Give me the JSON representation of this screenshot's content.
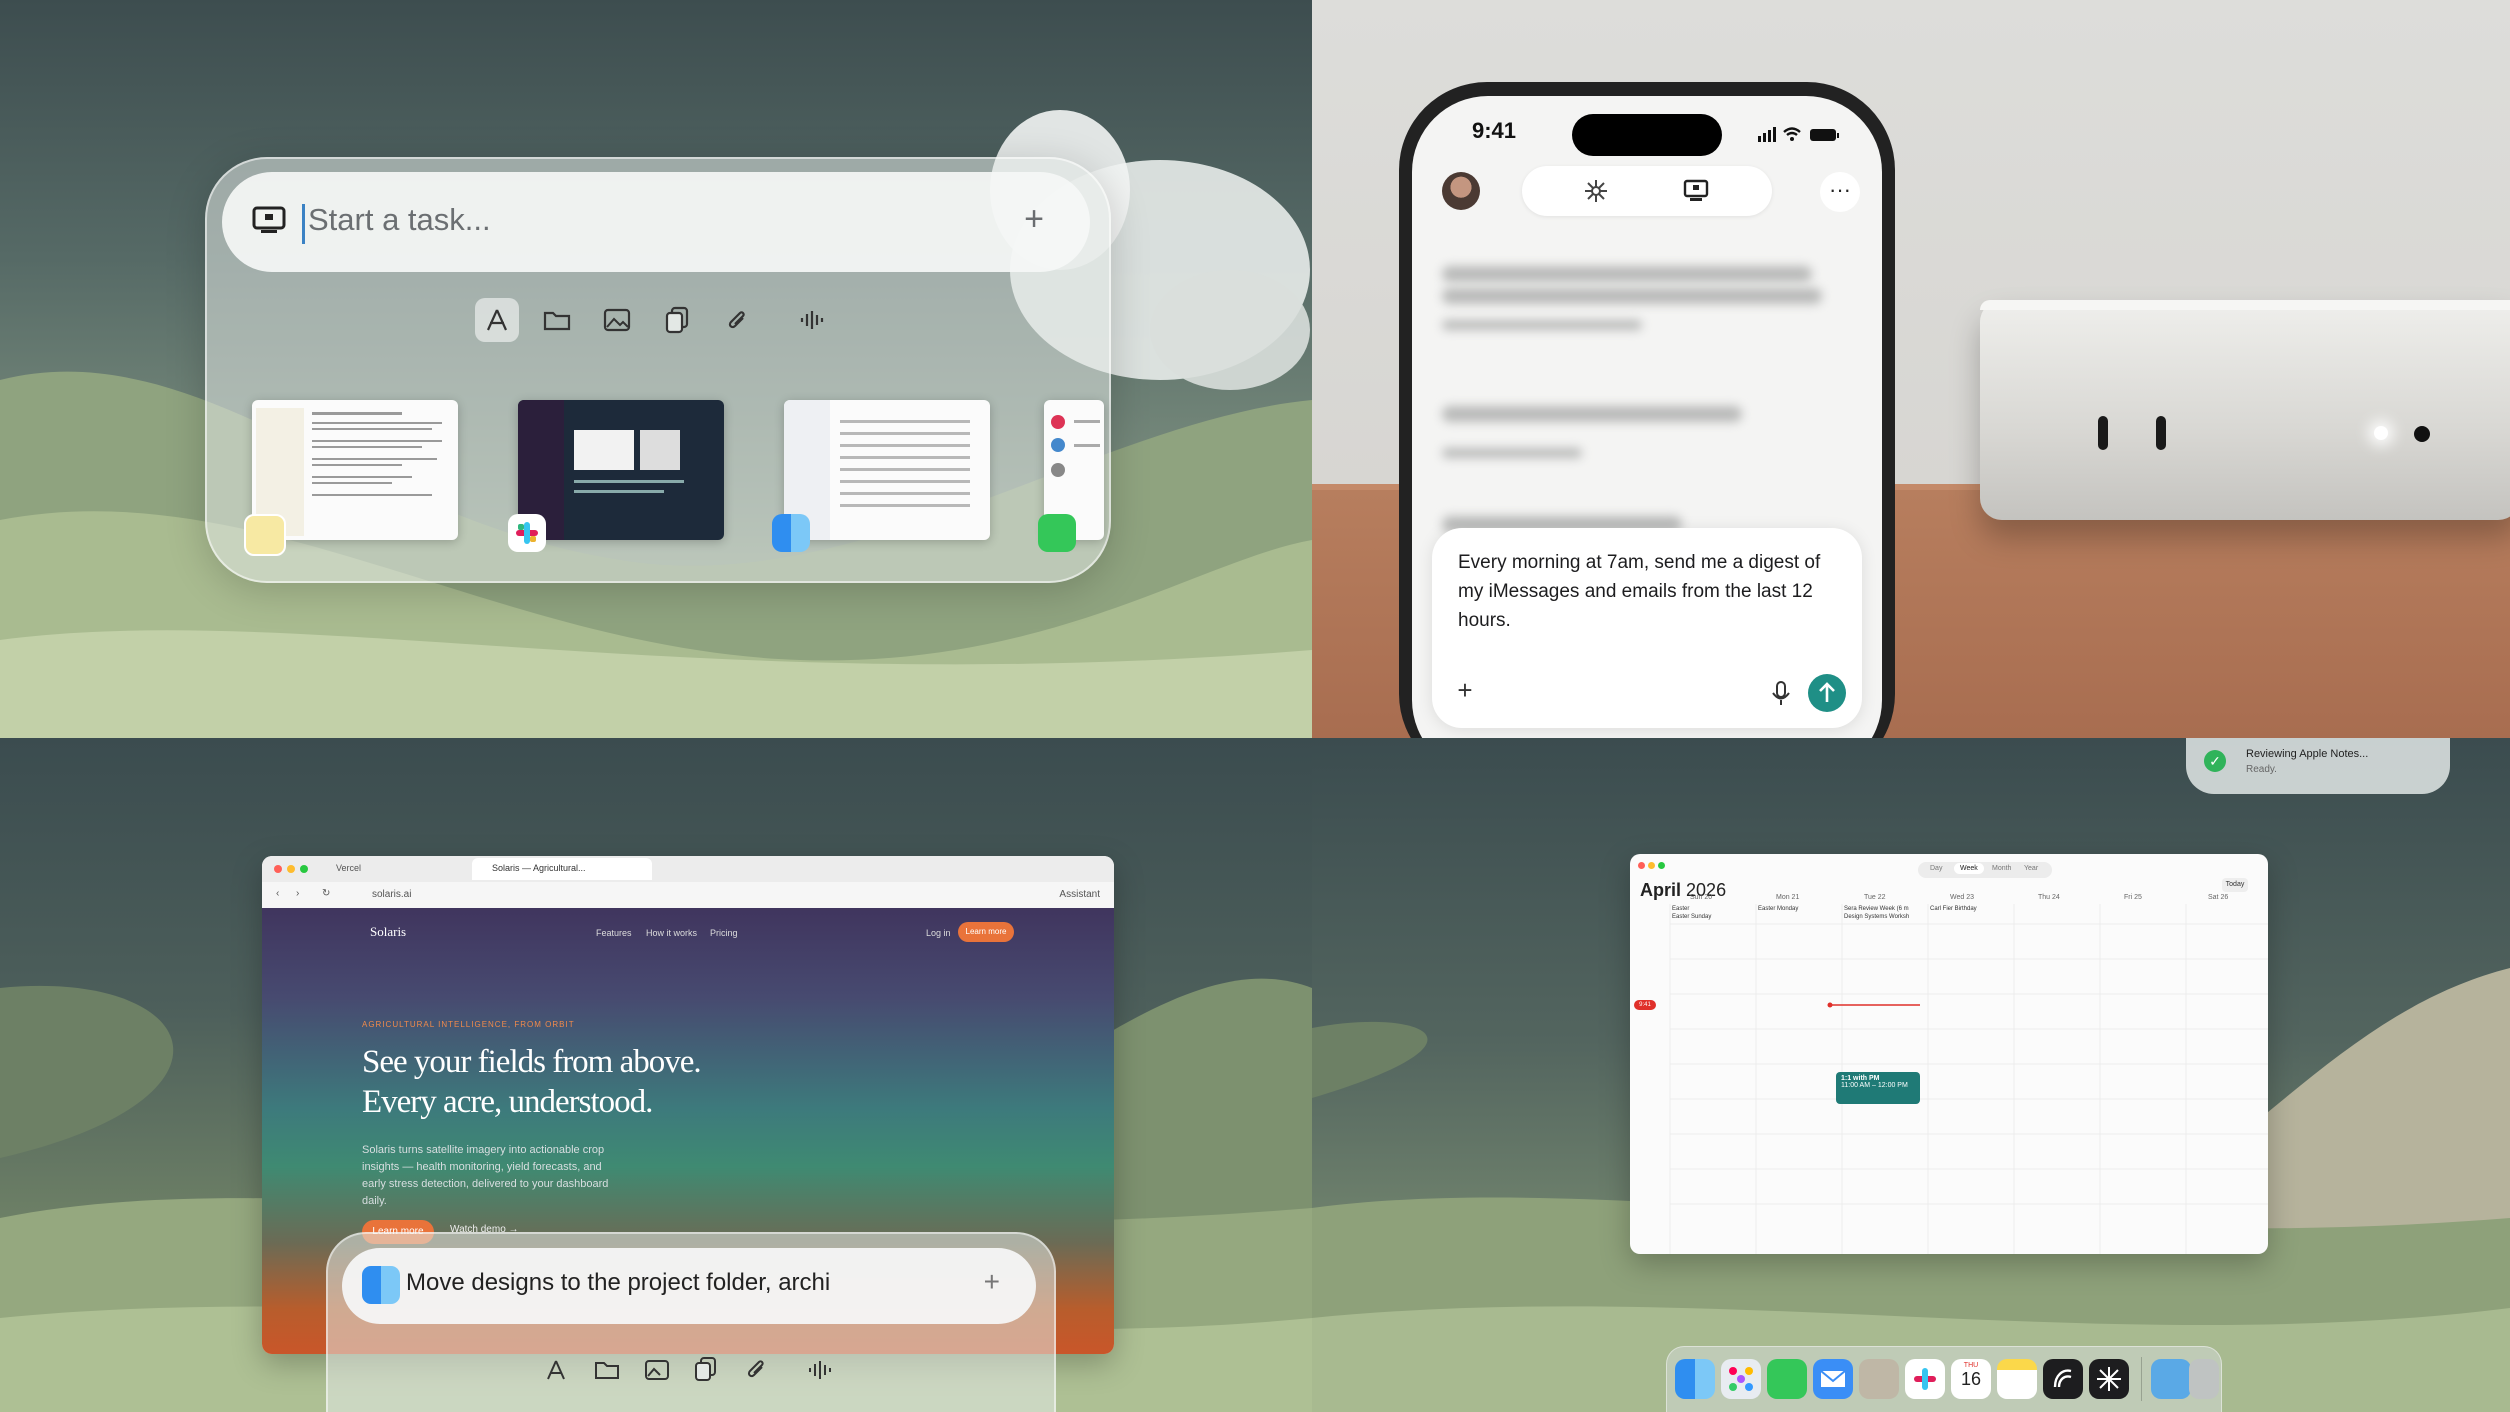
{
  "composer_desktop": {
    "placeholder": "Start a task...",
    "plus_label": "+",
    "tools": [
      "apps-icon",
      "folder-icon",
      "image-icon",
      "copy-icon",
      "attach-icon",
      "voice-icon"
    ],
    "windows": [
      {
        "name": "notes-window",
        "app_icon": "notes-icon"
      },
      {
        "name": "slack-window",
        "app_icon": "slack-icon"
      },
      {
        "name": "finder-window",
        "app_icon": "finder-icon"
      },
      {
        "name": "messages-window",
        "app_icon": "messages-icon"
      }
    ]
  },
  "phone": {
    "status_time": "9:41",
    "prompt": "Every morning at 7am, send me a digest of my iMessages and emails from the last 12 hours.",
    "plus_label": "+",
    "more_label": "···"
  },
  "browser": {
    "tabs": [
      "Vercel",
      "Solaris — Agricultural..."
    ],
    "address": "solaris.ai",
    "assistant_label": "Assistant",
    "site": {
      "logo": "Solaris",
      "nav": [
        "Features",
        "How it works",
        "Pricing"
      ],
      "login": "Log in",
      "cta_top": "Learn more",
      "kicker": "AGRICULTURAL INTELLIGENCE, FROM ORBIT",
      "title_line1": "See your fields from above.",
      "title_line2": "Every acre, understood.",
      "subtitle": "Solaris turns satellite imagery into actionable crop insights — health monitoring, yield forecasts, and early stress detection, delivered to your dashboard daily.",
      "cta": "Learn more",
      "demo": "Watch demo →"
    }
  },
  "composer_task": {
    "text": "Move designs to the project folder, archi",
    "plus_label": "+"
  },
  "toast": {
    "title": "Reviewing Apple Notes...",
    "status": "Ready."
  },
  "calendar": {
    "month": "April",
    "year": "2026",
    "views": [
      "Day",
      "Week",
      "Month",
      "Year"
    ],
    "today": "Today",
    "days": [
      "Sun 20",
      "Mon 21",
      "Tue 22",
      "Wed 23",
      "Thu 24",
      "Fri 25",
      "Sat 26"
    ],
    "events": [
      "Easter",
      "Easter Sunday",
      "Easter Monday",
      "Sera Review Week (6 m",
      "Design Systems Worksh",
      "Carl Fier Birthday"
    ],
    "current_time": "9:41",
    "meeting_title": "1:1 with PM",
    "meeting_time": "11:00 AM – 12:00 PM"
  },
  "dock": {
    "date_month": "THU",
    "date_day": "16",
    "apps": [
      "finder-icon",
      "launchpad-icon",
      "messages-icon",
      "mail-icon",
      "contacts-icon",
      "slack-icon",
      "calendar-icon",
      "notes-icon",
      "claude-icon",
      "agent-icon",
      "folder-icon",
      "trash-icon"
    ]
  }
}
